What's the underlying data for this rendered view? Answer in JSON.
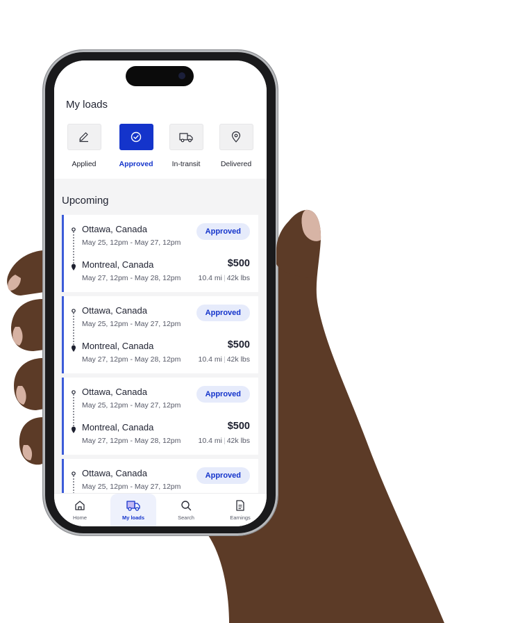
{
  "app": {
    "title": "My loads"
  },
  "tabs": [
    {
      "label": "Applied",
      "icon": "pencil-icon",
      "active": false
    },
    {
      "label": "Approved",
      "icon": "check-circle-icon",
      "active": true
    },
    {
      "label": "In-transit",
      "icon": "truck-icon",
      "active": false
    },
    {
      "label": "Delivered",
      "icon": "location-pin-icon",
      "active": false
    }
  ],
  "section": {
    "title": "Upcoming"
  },
  "loads": [
    {
      "from": "Ottawa, Canada",
      "from_window": "May 25, 12pm - May 27, 12pm",
      "to": "Montreal, Canada",
      "to_window": "May 27, 12pm - May 28, 12pm",
      "status": "Approved",
      "price": "$500",
      "distance": "10.4 mi",
      "weight": "42k lbs"
    },
    {
      "from": "Ottawa, Canada",
      "from_window": "May 25, 12pm - May 27, 12pm",
      "to": "Montreal, Canada",
      "to_window": "May 27, 12pm - May 28, 12pm",
      "status": "Approved",
      "price": "$500",
      "distance": "10.4 mi",
      "weight": "42k lbs"
    },
    {
      "from": "Ottawa, Canada",
      "from_window": "May 25, 12pm - May 27, 12pm",
      "to": "Montreal, Canada",
      "to_window": "May 27, 12pm - May 28, 12pm",
      "status": "Approved",
      "price": "$500",
      "distance": "10.4 mi",
      "weight": "42k lbs"
    },
    {
      "from": "Ottawa, Canada",
      "from_window": "May 25, 12pm - May 27, 12pm",
      "to": "",
      "to_window": "",
      "status": "Approved",
      "price": "",
      "distance": "",
      "weight": ""
    }
  ],
  "bottom_nav": [
    {
      "label": "Home",
      "icon": "home-icon",
      "active": false
    },
    {
      "label": "My loads",
      "icon": "truck-icon",
      "active": true
    },
    {
      "label": "Search",
      "icon": "search-icon",
      "active": false
    },
    {
      "label": "Earnings",
      "icon": "document-icon",
      "active": false
    }
  ],
  "colors": {
    "accent": "#1434cb",
    "badge_bg": "#e6ebfb",
    "card_border": "#3b5bd9",
    "text": "#1e2130"
  }
}
